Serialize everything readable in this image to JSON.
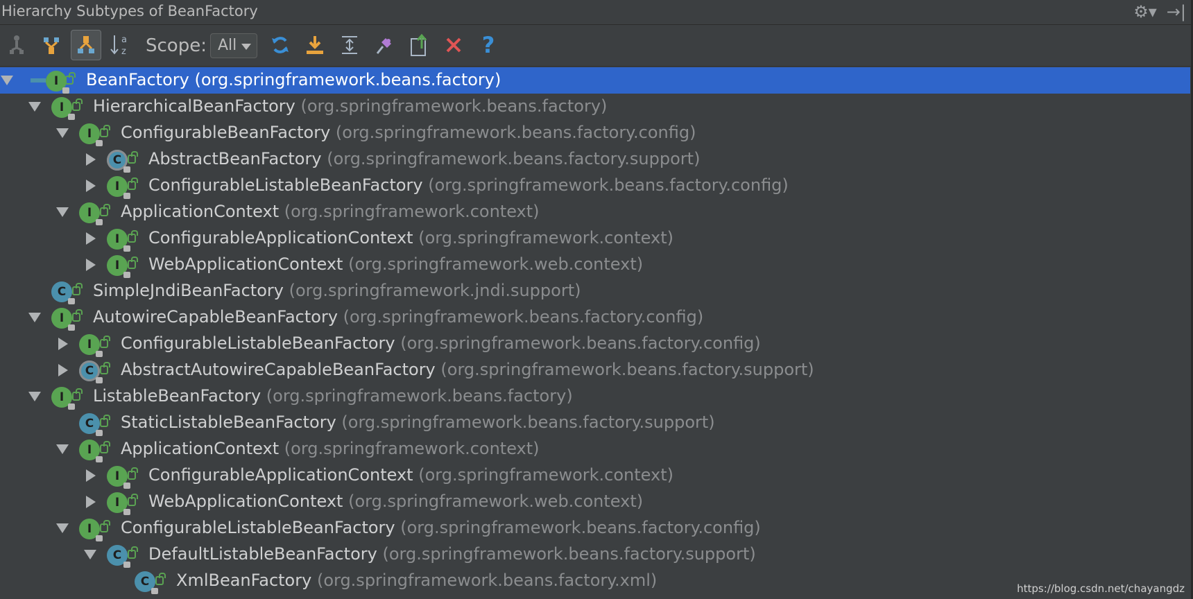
{
  "window": {
    "title": "Hierarchy Subtypes of BeanFactory"
  },
  "toolbar": {
    "scope_label": "Scope:",
    "scope_value": "All",
    "icons": [
      "supertypes-hierarchy-icon",
      "type-hierarchy-icon",
      "subtypes-hierarchy-icon",
      "sort-alphabetically-icon",
      "refresh-icon",
      "export-icon",
      "expand-all-icon",
      "pin-icon",
      "export-to-text-icon",
      "close-icon",
      "help-icon"
    ]
  },
  "tree": [
    {
      "depth": 0,
      "expand": "expanded",
      "kind": "i",
      "name": "BeanFactory",
      "pkg": "(org.springframework.beans.factory)",
      "selected": true
    },
    {
      "depth": 1,
      "expand": "expanded",
      "kind": "i",
      "name": "HierarchicalBeanFactory",
      "pkg": "(org.springframework.beans.factory)"
    },
    {
      "depth": 2,
      "expand": "expanded",
      "kind": "i",
      "name": "ConfigurableBeanFactory",
      "pkg": "(org.springframework.beans.factory.config)"
    },
    {
      "depth": 3,
      "expand": "collapsed",
      "kind": "ac",
      "name": "AbstractBeanFactory",
      "pkg": "(org.springframework.beans.factory.support)"
    },
    {
      "depth": 3,
      "expand": "collapsed",
      "kind": "i",
      "name": "ConfigurableListableBeanFactory",
      "pkg": "(org.springframework.beans.factory.config)"
    },
    {
      "depth": 2,
      "expand": "expanded",
      "kind": "i",
      "name": "ApplicationContext",
      "pkg": "(org.springframework.context)"
    },
    {
      "depth": 3,
      "expand": "collapsed",
      "kind": "i",
      "name": "ConfigurableApplicationContext",
      "pkg": "(org.springframework.context)"
    },
    {
      "depth": 3,
      "expand": "collapsed",
      "kind": "i",
      "name": "WebApplicationContext",
      "pkg": "(org.springframework.web.context)"
    },
    {
      "depth": 1,
      "expand": "none",
      "kind": "c",
      "name": "SimpleJndiBeanFactory",
      "pkg": "(org.springframework.jndi.support)"
    },
    {
      "depth": 1,
      "expand": "expanded",
      "kind": "i",
      "name": "AutowireCapableBeanFactory",
      "pkg": "(org.springframework.beans.factory.config)"
    },
    {
      "depth": 2,
      "expand": "collapsed",
      "kind": "i",
      "name": "ConfigurableListableBeanFactory",
      "pkg": "(org.springframework.beans.factory.config)"
    },
    {
      "depth": 2,
      "expand": "collapsed",
      "kind": "ac",
      "name": "AbstractAutowireCapableBeanFactory",
      "pkg": "(org.springframework.beans.factory.support)"
    },
    {
      "depth": 1,
      "expand": "expanded",
      "kind": "i",
      "name": "ListableBeanFactory",
      "pkg": "(org.springframework.beans.factory)"
    },
    {
      "depth": 2,
      "expand": "none",
      "kind": "c",
      "name": "StaticListableBeanFactory",
      "pkg": "(org.springframework.beans.factory.support)"
    },
    {
      "depth": 2,
      "expand": "expanded",
      "kind": "i",
      "name": "ApplicationContext",
      "pkg": "(org.springframework.context)"
    },
    {
      "depth": 3,
      "expand": "collapsed",
      "kind": "i",
      "name": "ConfigurableApplicationContext",
      "pkg": "(org.springframework.context)"
    },
    {
      "depth": 3,
      "expand": "collapsed",
      "kind": "i",
      "name": "WebApplicationContext",
      "pkg": "(org.springframework.web.context)"
    },
    {
      "depth": 2,
      "expand": "expanded",
      "kind": "i",
      "name": "ConfigurableListableBeanFactory",
      "pkg": "(org.springframework.beans.factory.config)"
    },
    {
      "depth": 3,
      "expand": "expanded",
      "kind": "c",
      "name": "DefaultListableBeanFactory",
      "pkg": "(org.springframework.beans.factory.support)"
    },
    {
      "depth": 4,
      "expand": "none",
      "kind": "c",
      "name": "XmlBeanFactory",
      "pkg": "(org.springframework.beans.factory.xml)"
    }
  ],
  "icon_letters": {
    "i": "I",
    "c": "C",
    "ac": "C"
  },
  "watermark": "https://blog.csdn.net/chayangdz",
  "colors": {
    "selection": "#2f65ca",
    "background": "#3c3f41",
    "interface_icon": "#59a452",
    "class_icon": "#4b90ac"
  }
}
